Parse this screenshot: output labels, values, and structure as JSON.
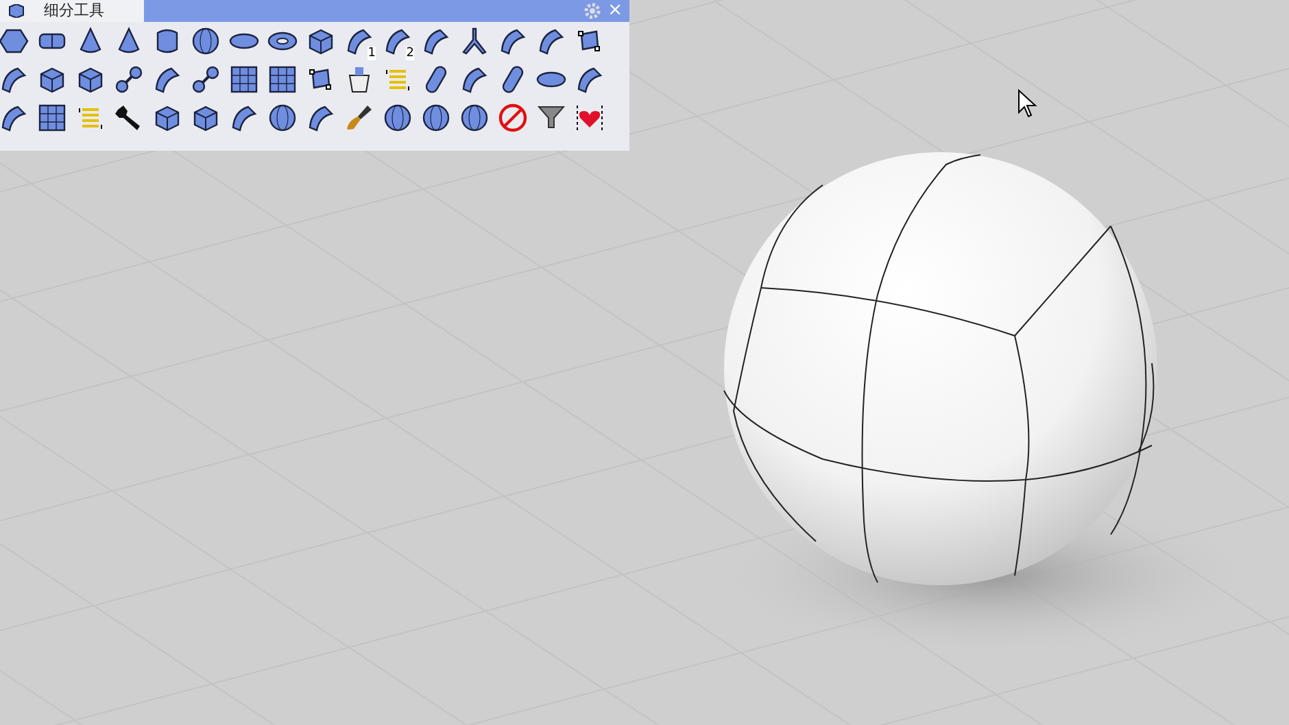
{
  "toolbar": {
    "title": "细分工具",
    "close": "×",
    "rows": [
      [
        {
          "kind": "hexagon"
        },
        {
          "kind": "slab"
        },
        {
          "kind": "cone"
        },
        {
          "kind": "cone"
        },
        {
          "kind": "cylinder"
        },
        {
          "kind": "sphere"
        },
        {
          "kind": "ellipse"
        },
        {
          "kind": "torus"
        },
        {
          "kind": "cube"
        },
        {
          "kind": "patch",
          "badge": "1"
        },
        {
          "kind": "patch",
          "badge": "2"
        },
        {
          "kind": "patch"
        },
        {
          "kind": "branch"
        },
        {
          "kind": "patch"
        },
        {
          "kind": "patch"
        },
        {
          "kind": "frame"
        }
      ],
      [
        {
          "kind": "patch"
        },
        {
          "kind": "cube"
        },
        {
          "kind": "cube"
        },
        {
          "kind": "dumbbell"
        },
        {
          "kind": "patch"
        },
        {
          "kind": "dumbbell"
        },
        {
          "kind": "grid"
        },
        {
          "kind": "grid"
        },
        {
          "kind": "frame"
        },
        {
          "kind": "bucket"
        },
        {
          "kind": "lines"
        },
        {
          "kind": "capsule"
        },
        {
          "kind": "patch"
        },
        {
          "kind": "capsule"
        },
        {
          "kind": "ellipse"
        },
        {
          "kind": "patch"
        }
      ],
      [
        {
          "kind": "patch"
        },
        {
          "kind": "grid"
        },
        {
          "kind": "lines"
        },
        {
          "kind": "wrench"
        },
        {
          "kind": "cube"
        },
        {
          "kind": "cube"
        },
        {
          "kind": "patch"
        },
        {
          "kind": "sphere"
        },
        {
          "kind": "patch"
        },
        {
          "kind": "brush"
        },
        {
          "kind": "sphere"
        },
        {
          "kind": "sphere"
        },
        {
          "kind": "sphere"
        },
        {
          "kind": "nosign"
        },
        {
          "kind": "funnel"
        },
        {
          "kind": "heart"
        }
      ]
    ]
  }
}
